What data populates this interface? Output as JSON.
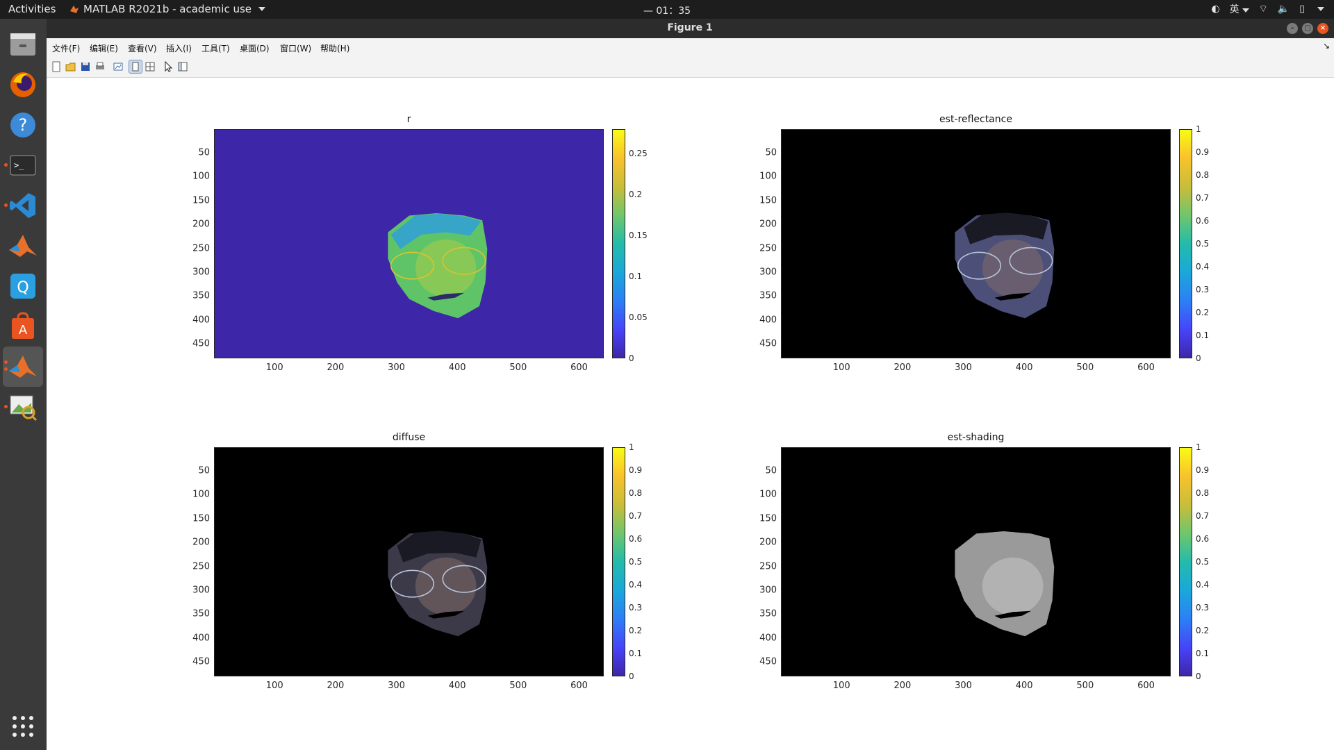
{
  "topbar": {
    "activities": "Activities",
    "app_name": "MATLAB R2021b - academic use",
    "clock": "— 01：35",
    "ime": "英"
  },
  "dock": {
    "items": [
      "files-icon",
      "firefox-icon",
      "help-icon",
      "terminal-icon",
      "vscode-icon",
      "matlab-icon",
      "chat-icon",
      "software-store-icon",
      "matlab-running-icon",
      "image-viewer-icon",
      "show-apps-icon"
    ]
  },
  "window": {
    "title": "Figure 1"
  },
  "menu": [
    "文件(F)",
    "编辑(E)",
    "查看(V)",
    "插入(I)",
    "工具(T)",
    "桌面(D)",
    "窗口(W)",
    "帮助(H)"
  ],
  "axes": [
    {
      "title": "r",
      "cbar_ticks": [
        "0.25",
        "0.2",
        "0.15",
        "0.1",
        "0.05",
        "0"
      ],
      "bg": "#3e26a8"
    },
    {
      "title": "est-reflectance",
      "cbar_ticks": [
        "1",
        "0.9",
        "0.8",
        "0.7",
        "0.6",
        "0.5",
        "0.4",
        "0.3",
        "0.2",
        "0.1",
        "0"
      ],
      "bg": "#000000"
    },
    {
      "title": "diffuse",
      "cbar_ticks": [
        "1",
        "0.9",
        "0.8",
        "0.7",
        "0.6",
        "0.5",
        "0.4",
        "0.3",
        "0.2",
        "0.1",
        "0"
      ],
      "bg": "#000000"
    },
    {
      "title": "est-shading",
      "cbar_ticks": [
        "1",
        "0.9",
        "0.8",
        "0.7",
        "0.6",
        "0.5",
        "0.4",
        "0.3",
        "0.2",
        "0.1",
        "0"
      ],
      "bg": "#000000"
    }
  ],
  "y_ticks": [
    "50",
    "100",
    "150",
    "200",
    "250",
    "300",
    "350",
    "400",
    "450"
  ],
  "x_ticks": [
    "100",
    "200",
    "300",
    "400",
    "500",
    "600"
  ]
}
